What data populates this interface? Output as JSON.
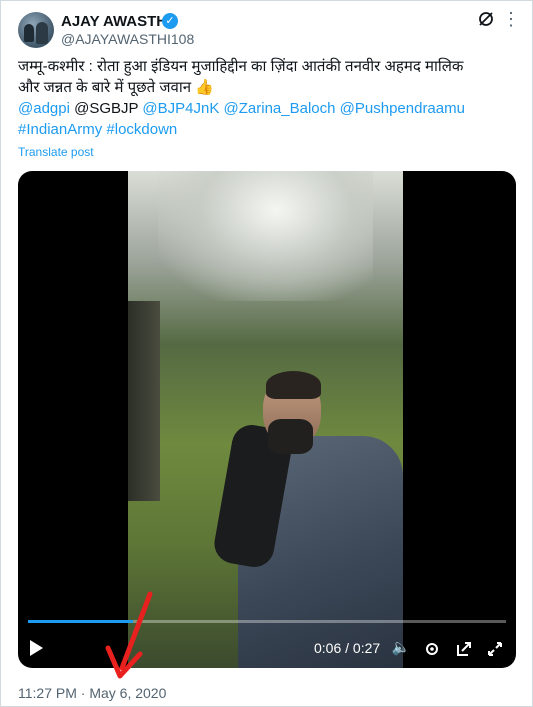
{
  "user": {
    "display_name": "AJAY AWASTHI",
    "handle": "@AJAYAWASTHI108",
    "verified_mark": "✓"
  },
  "tweet": {
    "line1": "जम्मू-कश्मीर : रोता हुआ इंडियन मुजाहिद्दीन का ज़िंदा आतंकी तनवीर अहमद मालिक",
    "line2": "और जन्नत के बारे में पूछते जवान",
    "emoji": "👍",
    "mentions": [
      "@adgpi",
      "@SGBJP",
      "@BJP4JnK",
      "@Zarina_Baloch",
      "@Pushpendraamu"
    ],
    "hashtags": [
      "#IndianArmy",
      "#lockdown"
    ],
    "translate_label": "Translate post",
    "timestamp": "11:27 PM · May 6, 2020"
  },
  "video": {
    "time_display": "0:06 / 0:27",
    "progress_fraction": 0.22
  },
  "colors": {
    "accent": "#1d9bf0",
    "annotation_arrow": "#e8201e"
  },
  "icons": [
    "grok-icon",
    "more-icon",
    "play-icon",
    "volume-icon",
    "settings-icon",
    "popout-icon",
    "fullscreen-icon"
  ]
}
